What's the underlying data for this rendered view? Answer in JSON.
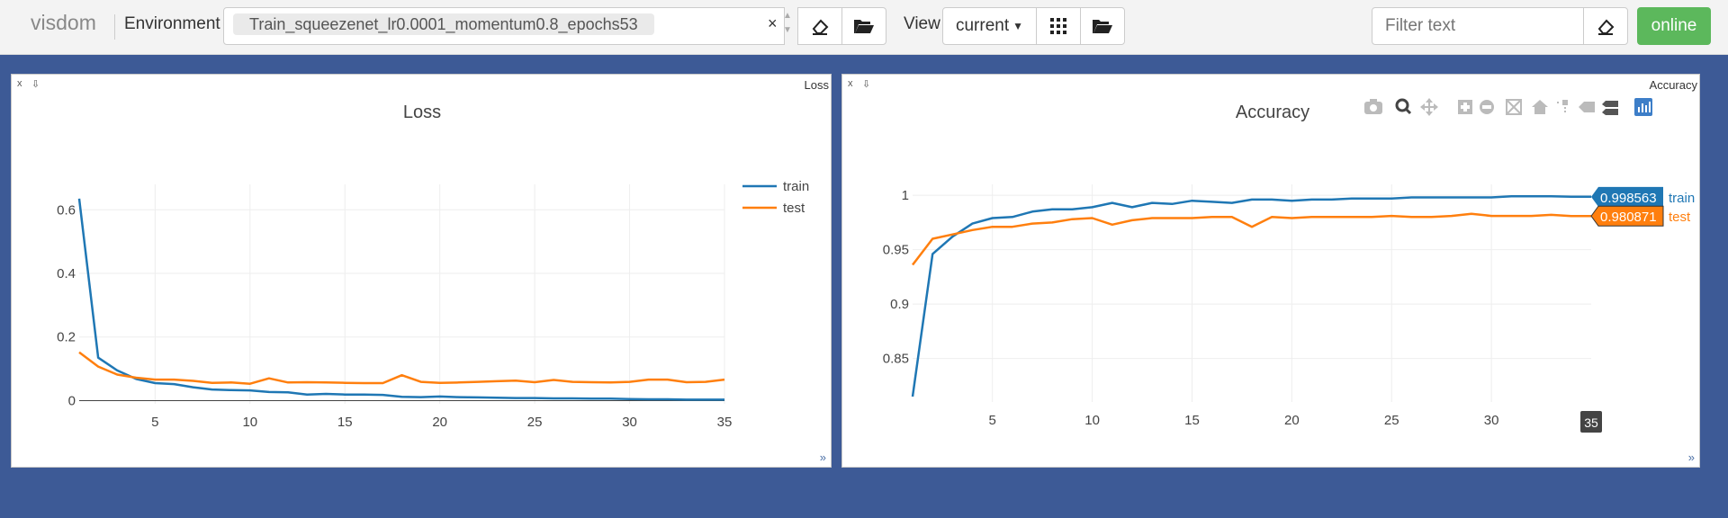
{
  "app": {
    "brand": "visdom"
  },
  "toolbar": {
    "environment_label": "Environment",
    "environment_value": "Train_squeezenet_lr0.0001_momentum0.8_epochs53",
    "clear_glyph": "×",
    "view_label": "View",
    "view_value": "current",
    "filter_placeholder": "Filter text",
    "online_label": "online"
  },
  "icons": {
    "eraser": "eraser-icon",
    "folder": "folder-open-icon",
    "grid": "grid-icon",
    "caret": "caret-down-icon",
    "camera": "camera-icon",
    "zoom": "zoom-icon",
    "pan": "pan-icon",
    "zoom_in": "zoom-in-icon",
    "zoom_out": "zoom-out-icon",
    "autoscale": "autoscale-icon",
    "home": "home-icon",
    "spike": "spike-lines-icon",
    "hover_closest": "hover-closest-icon",
    "hover_compare": "hover-compare-icon",
    "plotly": "plotly-logo-icon"
  },
  "colors": {
    "accent": "#3d5a96",
    "train": "#1f77b4",
    "test": "#ff7f0e",
    "online": "#5cb85c"
  },
  "panes": [
    {
      "name": "Loss",
      "close": "x",
      "pin": "⇩",
      "resize": "»"
    },
    {
      "name": "Accuracy",
      "close": "x",
      "pin": "⇩",
      "resize": "»"
    }
  ],
  "chart_data": [
    {
      "type": "line",
      "title": "Loss",
      "x": [
        1,
        2,
        3,
        4,
        5,
        6,
        7,
        8,
        9,
        10,
        11,
        12,
        13,
        14,
        15,
        16,
        17,
        18,
        19,
        20,
        21,
        22,
        23,
        24,
        25,
        26,
        27,
        28,
        29,
        30,
        31,
        32,
        33,
        34,
        35
      ],
      "xticks": [
        5,
        10,
        15,
        20,
        25,
        30,
        35
      ],
      "yticks": [
        0,
        0.2,
        0.4,
        0.6
      ],
      "xlim": [
        1,
        35
      ],
      "ylim": [
        -0.01,
        0.68
      ],
      "series": [
        {
          "name": "train",
          "values": [
            0.635,
            0.135,
            0.095,
            0.068,
            0.055,
            0.052,
            0.042,
            0.035,
            0.033,
            0.032,
            0.027,
            0.026,
            0.019,
            0.021,
            0.019,
            0.019,
            0.018,
            0.012,
            0.011,
            0.013,
            0.011,
            0.01,
            0.009,
            0.008,
            0.008,
            0.007,
            0.007,
            0.006,
            0.006,
            0.005,
            0.004,
            0.004,
            0.003,
            0.003,
            0.003
          ]
        },
        {
          "name": "test",
          "values": [
            0.152,
            0.107,
            0.082,
            0.072,
            0.066,
            0.066,
            0.062,
            0.056,
            0.057,
            0.053,
            0.07,
            0.057,
            0.058,
            0.057,
            0.056,
            0.055,
            0.055,
            0.08,
            0.059,
            0.056,
            0.057,
            0.059,
            0.061,
            0.063,
            0.058,
            0.065,
            0.059,
            0.058,
            0.057,
            0.059,
            0.066,
            0.066,
            0.058,
            0.059,
            0.066
          ]
        }
      ],
      "legend": "top-right",
      "grid": true
    },
    {
      "type": "line",
      "title": "Accuracy",
      "x": [
        1,
        2,
        3,
        4,
        5,
        6,
        7,
        8,
        9,
        10,
        11,
        12,
        13,
        14,
        15,
        16,
        17,
        18,
        19,
        20,
        21,
        22,
        23,
        24,
        25,
        26,
        27,
        28,
        29,
        30,
        31,
        32,
        33,
        34,
        35
      ],
      "xticks": [
        5,
        10,
        15,
        20,
        25,
        30
      ],
      "yticks": [
        0.85,
        0.9,
        0.95,
        1
      ],
      "xlim": [
        1,
        35
      ],
      "ylim": [
        0.81,
        1.01
      ],
      "series": [
        {
          "name": "train",
          "values": [
            0.815,
            0.946,
            0.962,
            0.974,
            0.979,
            0.98,
            0.985,
            0.987,
            0.987,
            0.989,
            0.993,
            0.989,
            0.993,
            0.992,
            0.995,
            0.994,
            0.993,
            0.996,
            0.996,
            0.995,
            0.996,
            0.996,
            0.997,
            0.997,
            0.997,
            0.998,
            0.998,
            0.998,
            0.998,
            0.998,
            0.999,
            0.999,
            0.999,
            0.998563,
            0.998563
          ]
        },
        {
          "name": "test",
          "values": [
            0.936,
            0.96,
            0.964,
            0.968,
            0.971,
            0.971,
            0.974,
            0.975,
            0.978,
            0.979,
            0.973,
            0.977,
            0.979,
            0.979,
            0.979,
            0.98,
            0.98,
            0.971,
            0.98,
            0.979,
            0.98,
            0.98,
            0.98,
            0.98,
            0.981,
            0.98,
            0.98,
            0.981,
            0.983,
            0.981,
            0.981,
            0.981,
            0.982,
            0.980871,
            0.980871
          ]
        }
      ],
      "hover": {
        "x": "35",
        "train": "0.998563",
        "test": "0.980871"
      },
      "grid": true
    }
  ]
}
